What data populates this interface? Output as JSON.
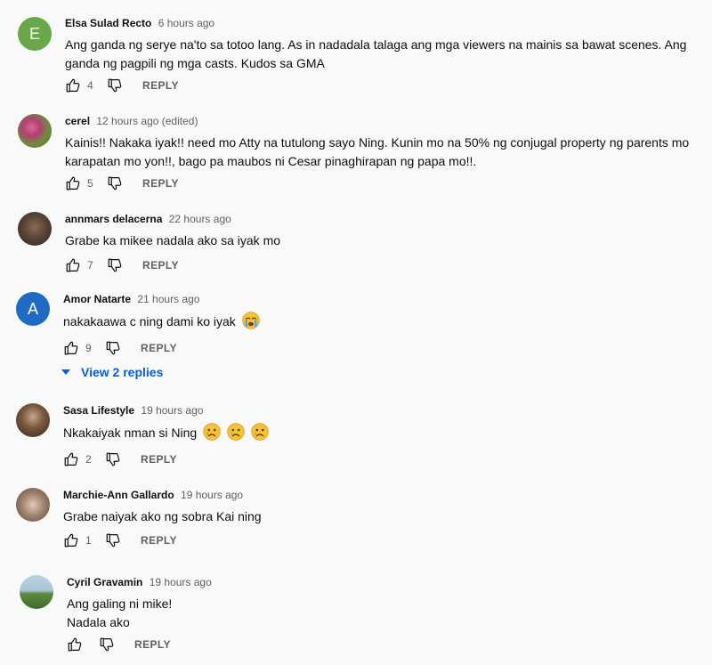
{
  "comments": [
    {
      "author": "Elsa Sulad Recto",
      "time": "6 hours ago",
      "text": "Ang ganda ng serye na'to sa totoo lang. As in nadadala talaga ang mga viewers na mainis sa bawat scenes. Ang ganda ng pagpili ng mga casts. Kudos sa GMA",
      "likes": "4",
      "reply_label": "REPLY",
      "avatar_letter": "E",
      "avatar_color": "#6aa64a"
    },
    {
      "author": "cerel",
      "time": "12 hours ago (edited)",
      "text": "Kainis!! Nakaka iyak!!  need mo Atty na tutulong sayo Ning.  Kunin mo na 50% ng conjugal  property ng parents mo karapatan mo yon!!, bago pa maubos ni Cesar  pinaghirapan ng papa mo!!.",
      "likes": "5",
      "reply_label": "REPLY"
    },
    {
      "author": "annmars delacerna",
      "time": "22 hours ago",
      "text": "Grabe ka mikee nadala ako sa iyak mo",
      "likes": "7",
      "reply_label": "REPLY"
    },
    {
      "author": "Amor Natarte",
      "time": "21 hours ago",
      "text": "nakakaawa c ning dami ko iyak",
      "likes": "9",
      "reply_label": "REPLY",
      "avatar_letter": "A",
      "avatar_color": "#1e6bc4",
      "view_replies": "View 2 replies"
    },
    {
      "author": "Sasa Lifestyle",
      "time": "19 hours ago",
      "text": "Nkakaiyak nman si Ning",
      "likes": "2",
      "reply_label": "REPLY"
    },
    {
      "author": "Marchie-Ann Gallardo",
      "time": "19 hours ago",
      "text": "Grabe naiyak ako ng sobra Kai ning",
      "likes": "1",
      "reply_label": "REPLY"
    },
    {
      "author": "Cyril Gravamin",
      "time": "19 hours ago",
      "text_lines": [
        "Ang galing ni mike!",
        "Nadala ako"
      ],
      "likes": "",
      "reply_label": "REPLY"
    }
  ]
}
